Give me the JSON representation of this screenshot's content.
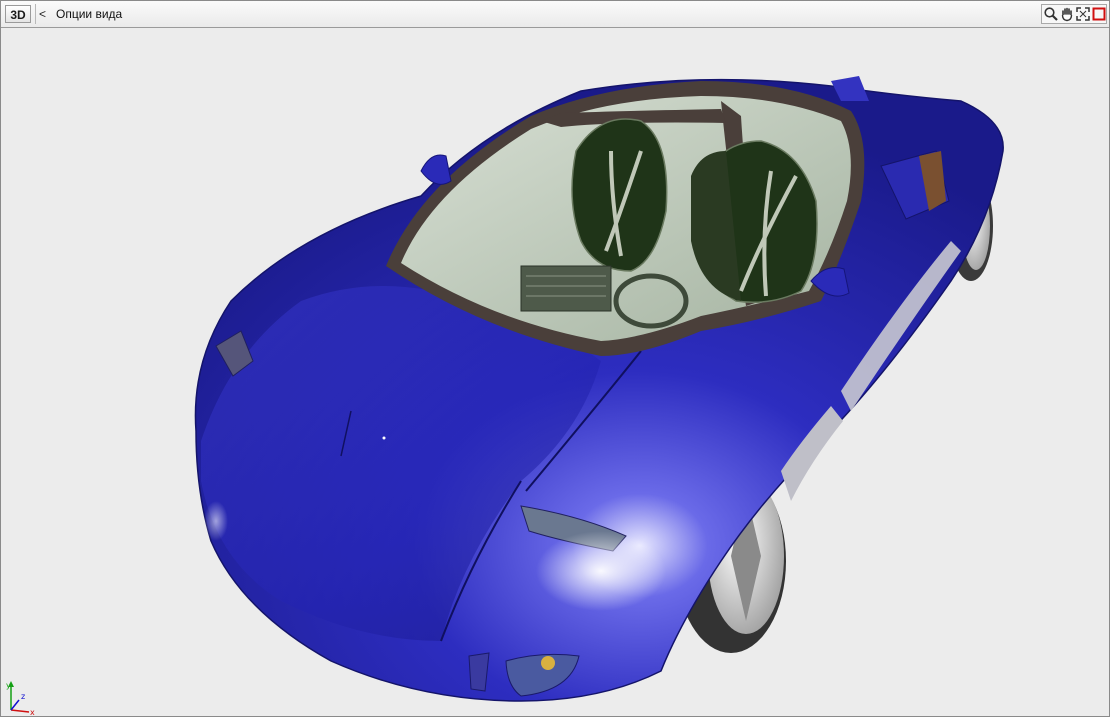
{
  "toolbar": {
    "mode_label": "3D",
    "back_label": "<",
    "view_options_label": "Опции вида",
    "tools": [
      {
        "icon": "zoom-icon"
      },
      {
        "icon": "pan-hand-icon"
      },
      {
        "icon": "fit-view-icon"
      },
      {
        "icon": "stop-icon"
      }
    ]
  },
  "viewport": {
    "model": "blue sports car 3D model",
    "axis": {
      "x_label": "x",
      "y_label": "y",
      "z_label": "z"
    }
  },
  "colors": {
    "car_body": "#2a2ab8",
    "car_body_dark": "#16167a",
    "glass": "#c9d6c6",
    "frame": "#4a3f3a",
    "tire": "#3a3a3a",
    "rim": "#d8d8d8",
    "background": "#ececec",
    "stop_red": "#d01010"
  }
}
